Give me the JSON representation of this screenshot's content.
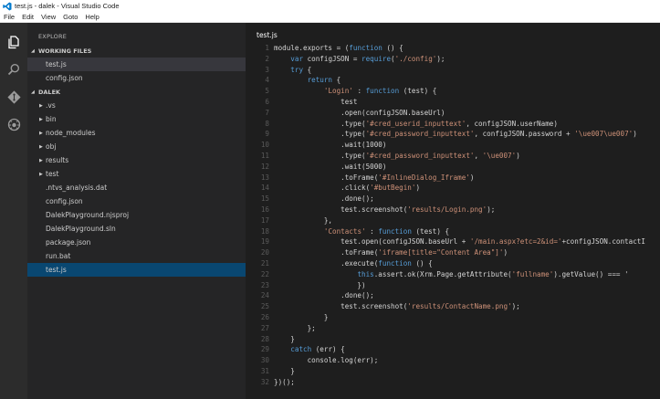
{
  "window": {
    "title": "test.js - dalek - Visual Studio Code"
  },
  "menu": [
    "File",
    "Edit",
    "View",
    "Goto",
    "Help"
  ],
  "activity": {
    "icons": [
      "files-icon",
      "search-icon",
      "git-icon",
      "debug-icon"
    ]
  },
  "sidebar": {
    "title": "EXPLORE",
    "working_files_header": "WORKING FILES",
    "working_files": [
      "test.js",
      "config.json"
    ],
    "project_header": "DALEK",
    "folders": [
      ".vs",
      "bin",
      "node_modules",
      "obj",
      "results",
      "test"
    ],
    "files": [
      ".ntvs_analysis.dat",
      "config.json",
      "DalekPlayground.njsproj",
      "DalekPlayground.sln",
      "package.json",
      "run.bat",
      "test.js"
    ]
  },
  "editor": {
    "tab_title": "test.js",
    "lines": [
      {
        "n": "1",
        "parts": [
          [
            "t",
            "module.exports = ("
          ],
          [
            "k",
            "function"
          ],
          [
            "t",
            " () {"
          ]
        ]
      },
      {
        "n": "2",
        "parts": [
          [
            "t",
            "    "
          ],
          [
            "k",
            "var"
          ],
          [
            "t",
            " configJSON = "
          ],
          [
            "k",
            "require"
          ],
          [
            "t",
            "("
          ],
          [
            "s",
            "'./config'"
          ],
          [
            "t",
            ");"
          ]
        ]
      },
      {
        "n": "3",
        "parts": [
          [
            "t",
            "    "
          ],
          [
            "k",
            "try"
          ],
          [
            "t",
            " {"
          ]
        ]
      },
      {
        "n": "4",
        "parts": [
          [
            "t",
            "        "
          ],
          [
            "k",
            "return"
          ],
          [
            "t",
            " {"
          ]
        ]
      },
      {
        "n": "5",
        "parts": [
          [
            "t",
            "            "
          ],
          [
            "s",
            "'Login'"
          ],
          [
            "t",
            " : "
          ],
          [
            "k",
            "function"
          ],
          [
            "t",
            " (test) {"
          ]
        ]
      },
      {
        "n": "6",
        "parts": [
          [
            "t",
            "                test"
          ]
        ]
      },
      {
        "n": "7",
        "parts": [
          [
            "t",
            "                .open(configJSON.baseUrl)"
          ]
        ]
      },
      {
        "n": "8",
        "parts": [
          [
            "t",
            "                .type("
          ],
          [
            "s",
            "'#cred_userid_inputtext'"
          ],
          [
            "t",
            ", configJSON.userName)"
          ]
        ]
      },
      {
        "n": "9",
        "parts": [
          [
            "t",
            "                .type("
          ],
          [
            "s",
            "'#cred_password_inputtext'"
          ],
          [
            "t",
            ", configJSON.password + "
          ],
          [
            "s",
            "'\\ue007\\ue007'"
          ],
          [
            "t",
            ")"
          ]
        ]
      },
      {
        "n": "10",
        "parts": [
          [
            "t",
            "                .wait(1000)"
          ]
        ]
      },
      {
        "n": "11",
        "parts": [
          [
            "t",
            "                .type("
          ],
          [
            "s",
            "'#cred_password_inputtext'"
          ],
          [
            "t",
            ", "
          ],
          [
            "s",
            "'\\ue007'"
          ],
          [
            "t",
            ")"
          ]
        ]
      },
      {
        "n": "12",
        "parts": [
          [
            "t",
            "                .wait(5000)"
          ]
        ]
      },
      {
        "n": "13",
        "parts": [
          [
            "t",
            "                .toFrame("
          ],
          [
            "s",
            "'#InlineDialog_Iframe'"
          ],
          [
            "t",
            ")"
          ]
        ]
      },
      {
        "n": "14",
        "parts": [
          [
            "t",
            "                .click("
          ],
          [
            "s",
            "'#butBegin'"
          ],
          [
            "t",
            ")"
          ]
        ]
      },
      {
        "n": "15",
        "parts": [
          [
            "t",
            "                .done();"
          ]
        ]
      },
      {
        "n": "16",
        "parts": [
          [
            "t",
            "                test.screenshot("
          ],
          [
            "s",
            "'results/Login.png'"
          ],
          [
            "t",
            ");"
          ]
        ]
      },
      {
        "n": "17",
        "parts": [
          [
            "t",
            "            },"
          ]
        ]
      },
      {
        "n": "18",
        "parts": [
          [
            "t",
            "            "
          ],
          [
            "s",
            "'Contacts'"
          ],
          [
            "t",
            " : "
          ],
          [
            "k",
            "function"
          ],
          [
            "t",
            " (test) {"
          ]
        ]
      },
      {
        "n": "19",
        "parts": [
          [
            "t",
            "                test.open(configJSON.baseUrl + "
          ],
          [
            "s",
            "'/main.aspx?etc=2&id='"
          ],
          [
            "t",
            "+configJSON.contactI"
          ]
        ]
      },
      {
        "n": "20",
        "parts": [
          [
            "t",
            "                .toFrame("
          ],
          [
            "s",
            "'iframe[title=\"Content Area\"]'"
          ],
          [
            "t",
            ")"
          ]
        ]
      },
      {
        "n": "21",
        "parts": [
          [
            "t",
            "                .execute("
          ],
          [
            "k",
            "function"
          ],
          [
            "t",
            " () {"
          ]
        ]
      },
      {
        "n": "22",
        "parts": [
          [
            "t",
            "                    "
          ],
          [
            "k",
            "this"
          ],
          [
            "t",
            ".assert.ok(Xrm.Page.getAttribute("
          ],
          [
            "s",
            "'fullname'"
          ],
          [
            "t",
            ").getValue() === '"
          ]
        ]
      },
      {
        "n": "23",
        "parts": [
          [
            "t",
            "                    })"
          ]
        ]
      },
      {
        "n": "24",
        "parts": [
          [
            "t",
            "                .done();"
          ]
        ]
      },
      {
        "n": "25",
        "parts": [
          [
            "t",
            "                test.screenshot("
          ],
          [
            "s",
            "'results/ContactName.png'"
          ],
          [
            "t",
            ");"
          ]
        ]
      },
      {
        "n": "26",
        "parts": [
          [
            "t",
            "            }"
          ]
        ]
      },
      {
        "n": "27",
        "parts": [
          [
            "t",
            "        };"
          ]
        ]
      },
      {
        "n": "28",
        "parts": [
          [
            "t",
            "    }"
          ]
        ]
      },
      {
        "n": "29",
        "parts": [
          [
            "t",
            "    "
          ],
          [
            "k",
            "catch"
          ],
          [
            "t",
            " (err) {"
          ]
        ]
      },
      {
        "n": "30",
        "parts": [
          [
            "t",
            "        console.log(err);"
          ]
        ]
      },
      {
        "n": "31",
        "parts": [
          [
            "t",
            "    }"
          ]
        ]
      },
      {
        "n": "32",
        "parts": [
          [
            "t",
            "})();"
          ]
        ]
      }
    ]
  }
}
